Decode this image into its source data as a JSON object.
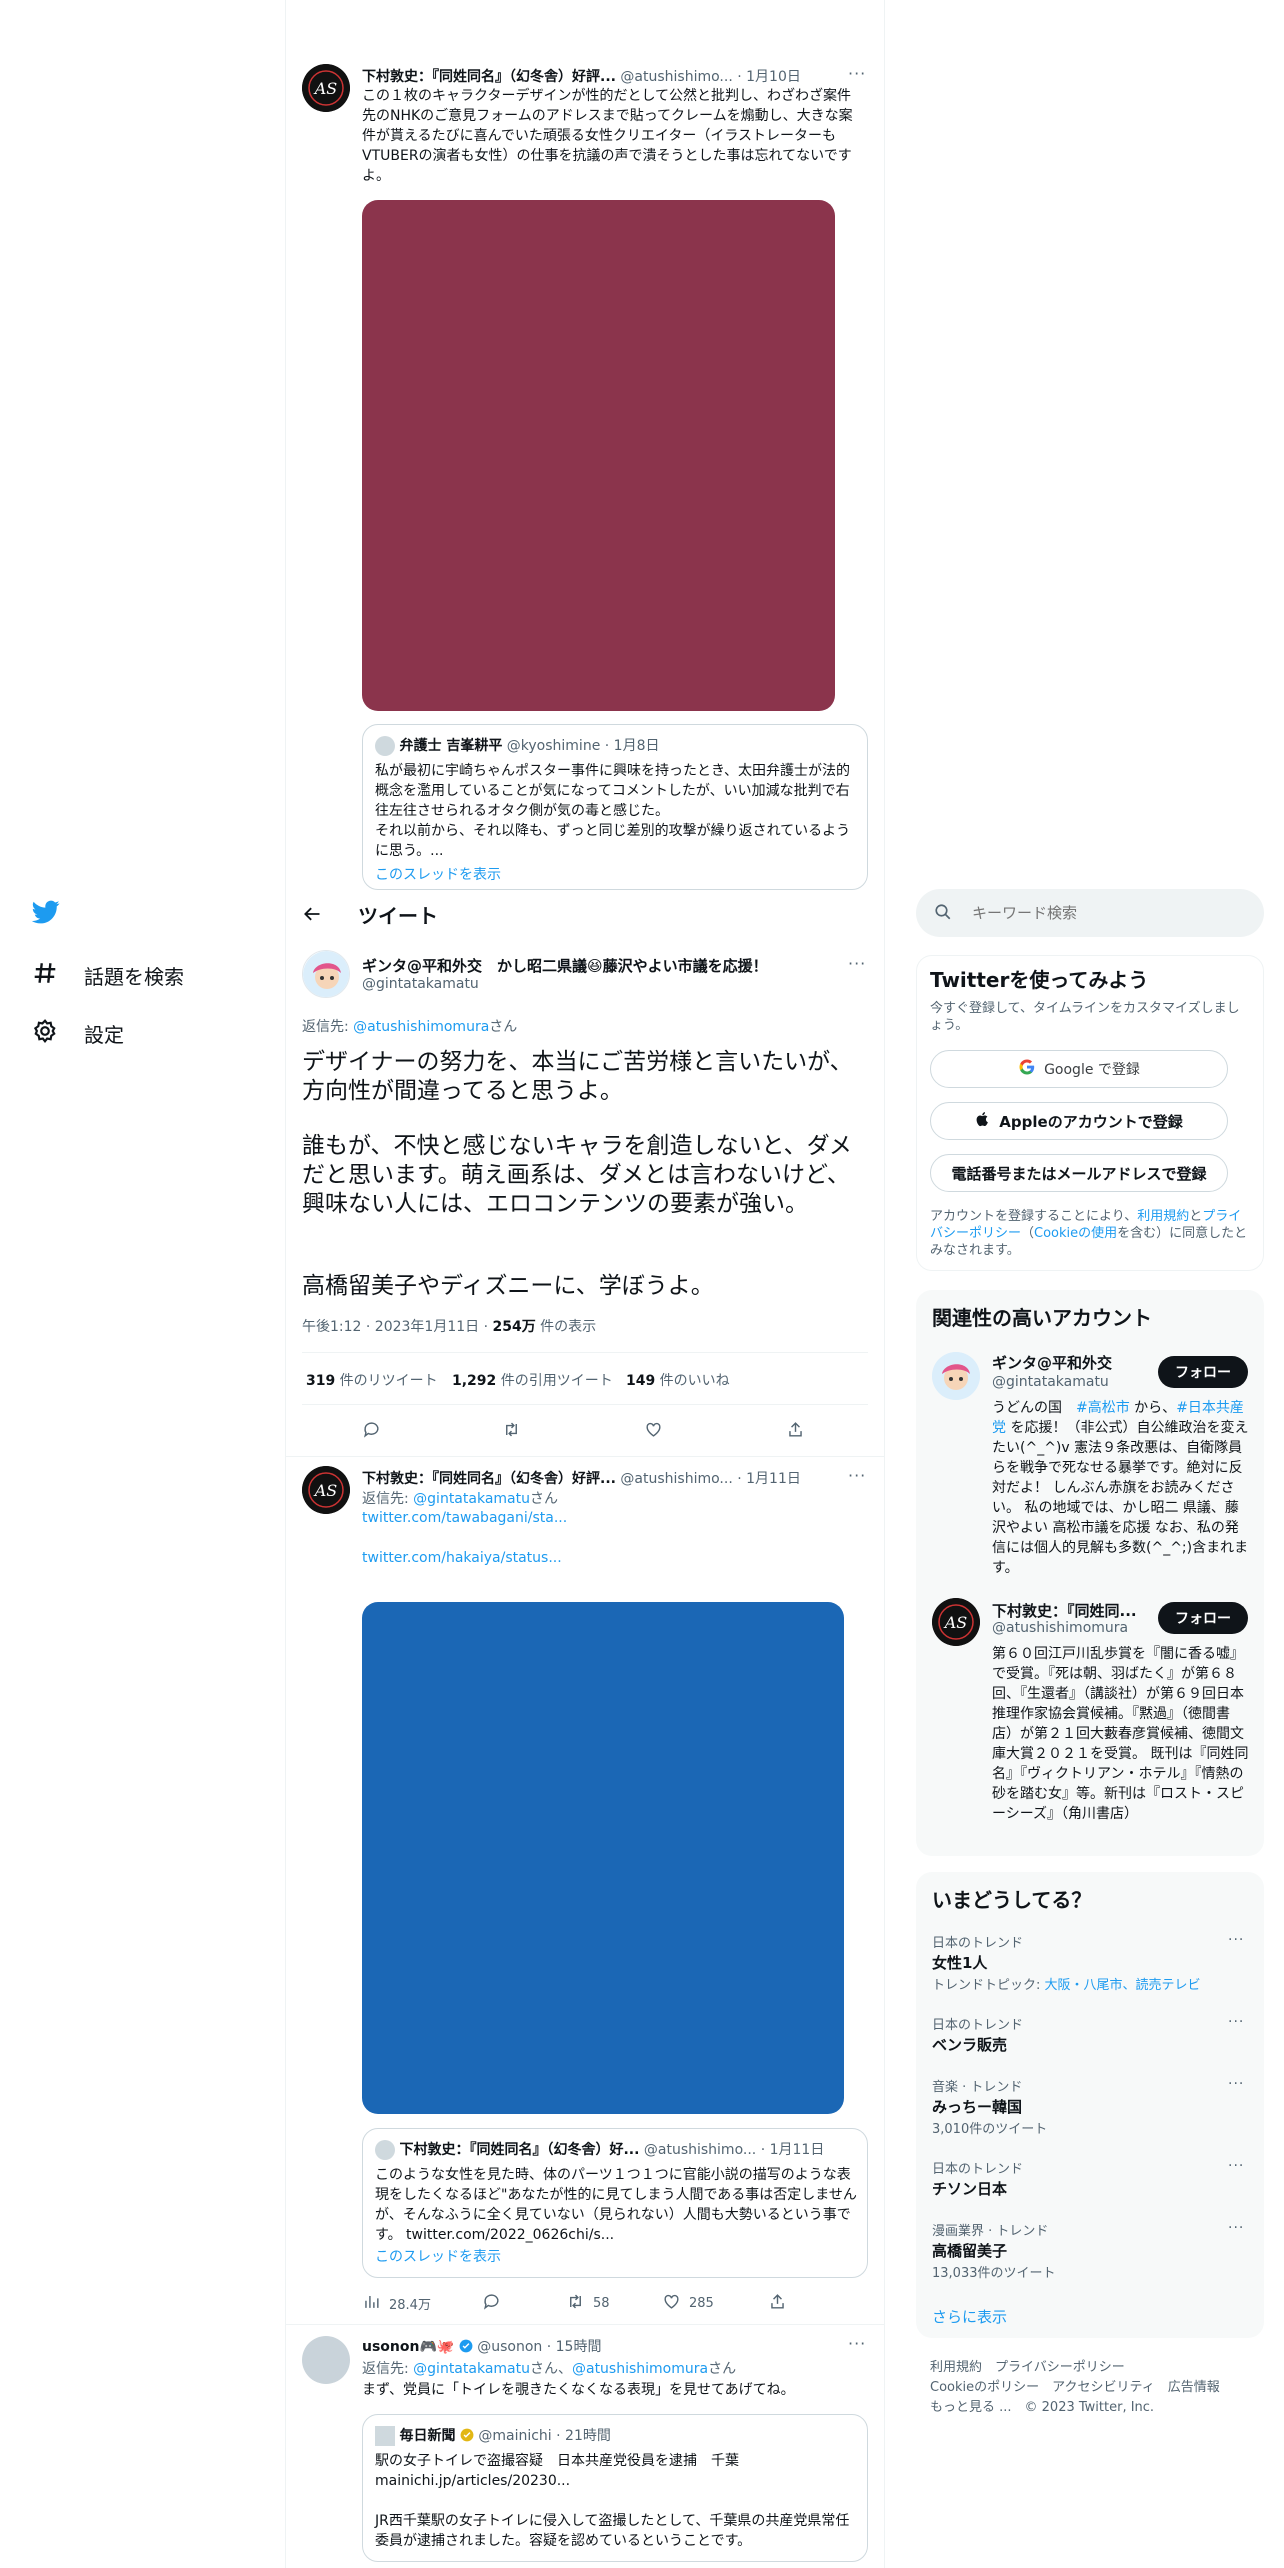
{
  "nav": {
    "explore_label": "話題を検索",
    "settings_label": "設定"
  },
  "header": {
    "title": "ツイート"
  },
  "tweet_top": {
    "name": "下村敦史：『同姓同名』（幻冬舎）好評...",
    "handle": "@atushishimo...",
    "time": "· 1月10日",
    "text": "この１枚のキャラクターデザインが性的だとして公然と批判し、わざわざ案件先のNHKのご意見フォームのアドレスまで貼ってクレームを煽動し、大きな案件が貰えるたびに喜んでいた頑張る女性クリエイター（イラストレーターもVTUBERの演者も女性）の仕事を抗議の声で潰そうとした事は忘れてないですよ。",
    "quote": {
      "name": "弁護士 吉峯耕平",
      "handle": "@kyoshimine",
      "time": "· 1月8日",
      "text": "私が最初に宇崎ちゃんポスター事件に興味を持ったとき、太田弁護士が法的概念を濫用していることが気になってコメントしたが、いい加減な批判で右往左往させられるオタク側が気の毒と感じた。\nそれ以前から、それ以降も、ずっと同じ差別的攻撃が繰り返されているように思う。...",
      "show_thread": "このスレッドを表示"
    }
  },
  "main_tweet": {
    "name": "ギンタ@平和外交　かし昭二県議😆藤沢やよい市議を応援！",
    "handle": "@gintatakamatu",
    "reply_prefix": "返信先: ",
    "reply_to": "@atushishimomura",
    "reply_suffix": "さん",
    "p1": "デザイナーの努力を、本当にご苦労様と言いたいが、方向性が間違ってると思うよ。",
    "p2": "誰もが、不快と感じないキャラを創造しないと、ダメだと思います。萌え画系は、ダメとは言わないけど、興味ない人には、エロコンテンツの要素が強い。",
    "p3": "高橋留美子やディズニーに、学ぼうよ。",
    "time": "午後1:12 · 2023年1月11日 · ",
    "views": "254万",
    "views_label": " 件の表示",
    "retweets": "319",
    "retweets_label": " 件のリツイート",
    "quotes": "1,292",
    "quotes_label": " 件の引用ツイート",
    "likes": "149",
    "likes_label": " 件のいいね"
  },
  "reply1": {
    "name": "下村敦史：『同姓同名』（幻冬舎）好評...",
    "handle": "@atushishimo...",
    "time": "· 1月11日",
    "reply_prefix": "返信先: ",
    "reply_to": "@gintatakamatu",
    "reply_suffix": "さん",
    "link1": "twitter.com/tawabagani/sta...",
    "link2": "twitter.com/hakaiya/status...",
    "quote": {
      "name": "下村敦史：『同姓同名』（幻冬舎）好...",
      "handle": "@atushishimo...",
      "time": "· 1月11日",
      "text": "このような女性を見た時、体のパーツ１つ１つに官能小説の描写のような表現をしたくなるほど\"あなたが性的に見てしまう人間である事は否定しませんが、そんなふうに全く見ていない（見られない）人間も大勢いるという事です。 twitter.com/2022_0626chi/s...",
      "show_thread": "このスレッドを表示"
    },
    "views": "28.4万",
    "retweets": "58",
    "likes": "285"
  },
  "reply2": {
    "name": "usonon🎮🐙",
    "handle": "@usonon",
    "time": "· 15時間",
    "reply_prefix": "返信先: ",
    "reply_to": "@gintatakamatu",
    "reply_mid": "さん、",
    "reply_to2": "@atushishimomura",
    "reply_suffix": "さん",
    "text": "まず、党員に「トイレを覗きたくなくなる表現」を見せてあげてね。",
    "quote": {
      "name": "毎日新聞",
      "handle": "@mainichi",
      "time": "· 21時間",
      "line1": "駅の女子トイレで盗撮容疑　日本共産党役員を逮捕　千葉",
      "line2": "mainichi.jp/articles/20230...",
      "line3": "JR西千葉駅の女子トイレに侵入して盗撮したとして、千葉県の共産党県常任委員が逮捕されました。容疑を認めているということです。"
    }
  },
  "sidebar": {
    "search_placeholder": "キーワード検索",
    "signup": {
      "title": "Twitterを使ってみよう",
      "subtitle": "今すぐ登録して、タイムラインをカスタマイズしましょう。",
      "google": "Google で登録",
      "apple": "Appleのアカウントで登録",
      "phone": "電話番号またはメールアドレスで登録",
      "terms_a": "アカウントを登録することにより、",
      "terms_link1": "利用規約",
      "terms_b": "と",
      "terms_link2": "プライバシーポリシー",
      "terms_c": "（",
      "terms_link3": "Cookieの使用",
      "terms_d": "を含む）に同意したとみなされます。"
    },
    "related": {
      "title": "関連性の高いアカウント",
      "accounts": [
        {
          "name": "ギンタ@平和外交",
          "handle": "@gintatakamatu",
          "follow": "フォロー",
          "bio_a": "うどんの国　",
          "bio_tag1": "#高松市",
          "bio_b": " から、",
          "bio_tag2": "#日本共産党",
          "bio_c": " を応援！（非公式）自公維政治を変えたい(^_^)v 憲法９条改悪は、自衛隊員らを戦争で死なせる暴挙です。絶対に反対だよ！ しんぶん赤旗をお読みください。 私の地域では、かし昭二 県議、藤沢やよい 高松市議を応援 なお、私の発信には個人的見解も多数(^_^;)含まれます。"
        },
        {
          "name": "下村敦史：『同姓同...",
          "handle": "@atushishimomura",
          "follow": "フォロー",
          "bio": "第６０回江戸川乱歩賞を『闇に香る嘘』で受賞。『死は朝、羽ばたく』が第６８回、『生還者』（講談社）が第６９回日本推理作家協会賞候補。『黙過』（徳間書店）が第２１回大藪春彦賞候補、徳間文庫大賞２０２１を受賞。 既刊は『同姓同名』『ヴィクトリアン・ホテル』『情熱の砂を踏む女』等。新刊は『ロスト・スピーシーズ』（角川書店）"
        }
      ]
    },
    "trends": {
      "title": "いまどうしてる？",
      "items": [
        {
          "category": "日本のトレンド",
          "name": "女性1人",
          "sub_a": "トレンドトピック: ",
          "sub_link": "大阪・八尾市、読売テレビ"
        },
        {
          "category": "日本のトレンド",
          "name": "ベンラ販売"
        },
        {
          "category": "音楽 · トレンド",
          "name": "みっちー韓国",
          "sub": "3,010件のツイート"
        },
        {
          "category": "日本のトレンド",
          "name": "チソン日本"
        },
        {
          "category": "漫画業界 · トレンド",
          "name": "高橋留美子",
          "sub": "13,033件のツイート"
        }
      ],
      "show_more": "さらに表示"
    },
    "footer": {
      "line1": "利用規約　プライバシーポリシー",
      "line2": "Cookieのポリシー　アクセシビリティ　広告情報",
      "line3": "もっと見る ...　© 2023 Twitter, Inc."
    }
  },
  "colors": {
    "accent": "#1d9bf0",
    "media_red": "#8b344c",
    "media_blue": "#1b67b5"
  }
}
